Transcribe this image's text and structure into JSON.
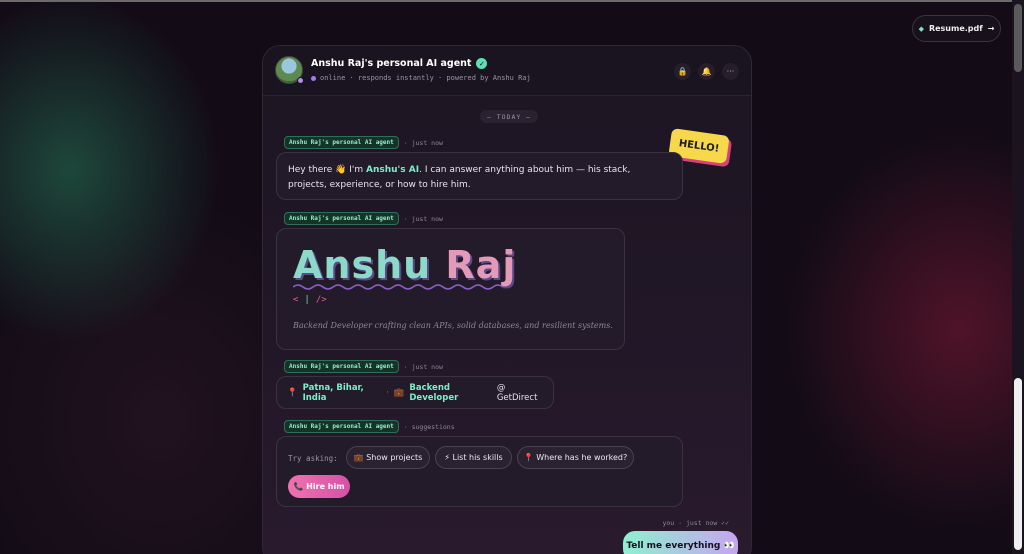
{
  "resume": {
    "label": "Resume.pdf",
    "arrow": "→",
    "dot": "◆"
  },
  "header": {
    "title": "Anshu Raj's personal AI agent",
    "verified": "✓",
    "subtitle": "online · responds instantly · powered by Anshu Raj",
    "icons": [
      "lock-icon",
      "bell-icon",
      "more-icon"
    ],
    "icon_glyphs": [
      "🔒",
      "🔔",
      "···"
    ]
  },
  "sticker": "HELLO!",
  "divider": "— TODAY —",
  "messages": [
    {
      "sender": "Anshu Raj's personal AI agent",
      "time": "· just now",
      "text_pre": "Hey there 👋 I'm ",
      "text_highlight": "Anshu's AI",
      "text_post": ". I can answer anything about him — his stack, projects, experience, or how to hire him."
    },
    {
      "sender": "Anshu Raj's personal AI agent",
      "time": "· just now",
      "name_part1": "Anshu",
      "name_part2": "Raj",
      "code_open": "<",
      "code_cursor": "|",
      "code_close": "/>",
      "tagline": "Backend Developer crafting clean APIs, solid databases, and resilient systems."
    },
    {
      "sender": "Anshu Raj's personal AI agent",
      "time": "· just now",
      "pin": "📍",
      "location": "Patna, Bihar, India",
      "separator": "·",
      "briefcase": "💼",
      "role": "Backend Developer",
      "company": "@ GetDirect"
    },
    {
      "sender": "Anshu Raj's personal AI agent",
      "time": "· suggestions",
      "try_label": "Try asking:",
      "chips": [
        {
          "label": "💼 Show projects"
        },
        {
          "label": "⚡ List his skills"
        },
        {
          "label": "📍 Where has he worked?"
        }
      ],
      "hire": "📞 Hire him"
    }
  ],
  "user_message": {
    "meta": "you · just now ✓✓",
    "text": "Tell me everything 👀"
  },
  "colors": {
    "accent_green": "#7bf0c8",
    "accent_pink": "#f072b0",
    "sticker_yellow": "#f6d84a"
  }
}
